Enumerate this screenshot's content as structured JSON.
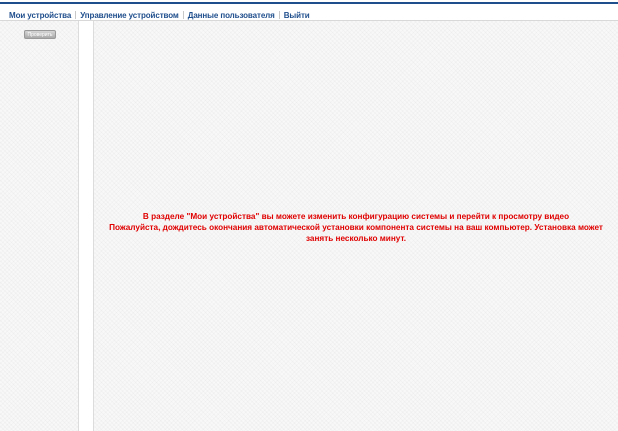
{
  "nav": {
    "items": [
      {
        "label": "Мои устройства"
      },
      {
        "label": "Управление устройством"
      },
      {
        "label": "Данные пользователя"
      },
      {
        "label": "Выйти"
      }
    ]
  },
  "sidebar": {
    "button_label": "Проверить"
  },
  "main": {
    "message_line1": "В разделе \"Мои устройства\" вы можете изменить конфигурацию системы и перейти к просмотру видео",
    "message_line2": "Пожалуйста, дождитесь окончания автоматической установки компонента системы на ваш компьютер. Установка может занять несколько минут."
  },
  "colors": {
    "nav_link": "#1f4e8c",
    "message": "#e00000",
    "top_rule": "#1f4e8c"
  }
}
